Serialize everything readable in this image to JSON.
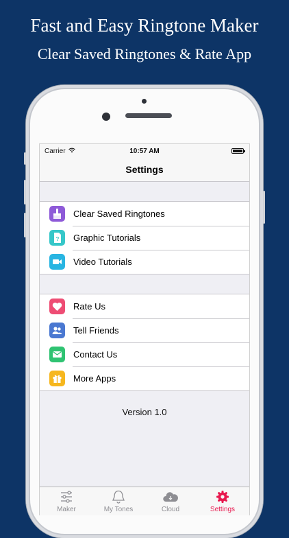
{
  "promo": {
    "title": "Fast and Easy Ringtone Maker",
    "subtitle": "Clear Saved Ringtones & Rate App"
  },
  "status_bar": {
    "carrier": "Carrier",
    "time": "10:57 AM"
  },
  "nav": {
    "title": "Settings"
  },
  "groups": [
    {
      "items": [
        {
          "label": "Clear Saved Ringtones",
          "icon": "broom-icon",
          "color": "#8e5ad8"
        },
        {
          "label": "Graphic Tutorials",
          "icon": "document-icon",
          "color": "#36c7c9"
        },
        {
          "label": "Video Tutorials",
          "icon": "video-camera-icon",
          "color": "#28b5e2"
        }
      ]
    },
    {
      "items": [
        {
          "label": "Rate Us",
          "icon": "heart-icon",
          "color": "#ee4d74"
        },
        {
          "label": "Tell Friends",
          "icon": "friends-icon",
          "color": "#4a78d1"
        },
        {
          "label": "Contact Us",
          "icon": "envelope-icon",
          "color": "#2fc372"
        },
        {
          "label": "More Apps",
          "icon": "gift-icon",
          "color": "#f6b71e"
        }
      ]
    }
  ],
  "version": "Version 1.0",
  "tabs": [
    {
      "label": "Maker",
      "icon": "sliders-icon",
      "active": false
    },
    {
      "label": "My Tones",
      "icon": "bell-icon",
      "active": false
    },
    {
      "label": "Cloud",
      "icon": "cloud-icon",
      "active": false
    },
    {
      "label": "Settings",
      "icon": "gear-icon",
      "active": true
    }
  ],
  "colors": {
    "background": "#0d3466",
    "tab_active": "#e8194f",
    "tab_inactive": "#8e8e93"
  }
}
